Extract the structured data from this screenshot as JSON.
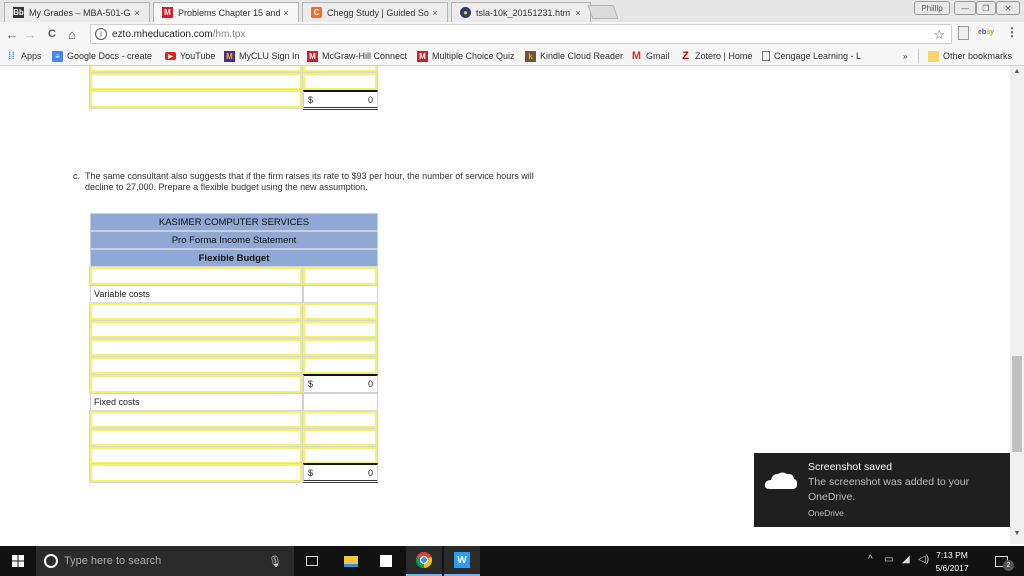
{
  "browser": {
    "tabs": [
      {
        "title": "My Grades – MBA-501-G",
        "icon": "blackboard-icon",
        "icon_text": "Bb",
        "icon_color": "#333333",
        "active": false
      },
      {
        "title": "Problems Chapter 15 and",
        "icon": "mcgraw-hill-icon",
        "icon_text": "M",
        "icon_color": "#d51f26",
        "active": true
      },
      {
        "title": "Chegg Study | Guided So",
        "icon": "chegg-icon",
        "icon_text": "C",
        "icon_color": "#f36c21",
        "active": false
      },
      {
        "title": "tsla-10k_20151231.htm",
        "icon": "sec-seal-icon",
        "icon_text": "●",
        "icon_color": "#2b3a67",
        "active": false
      }
    ],
    "close_glyph": "×",
    "profile_name": "Phillip",
    "window_controls": {
      "minimize": "—",
      "maximize": "❐",
      "close": "✕"
    },
    "nav": {
      "back": "←",
      "forward": "→",
      "reload": "C",
      "home": "⌂"
    },
    "url": {
      "host": "ezto.mheducation.com",
      "path": "/hm.tpx"
    },
    "bookmarks": [
      {
        "label": "Apps",
        "icon": "apps-grid-icon"
      },
      {
        "label": "Google Docs - create",
        "icon": "google-docs-icon"
      },
      {
        "label": "YouTube",
        "icon": "youtube-icon"
      },
      {
        "label": "MyCLU Sign In",
        "icon": "myclu-icon"
      },
      {
        "label": "McGraw-Hill Connect",
        "icon": "mcgraw-hill-icon"
      },
      {
        "label": "Multiple Choice Quiz",
        "icon": "mcgraw-hill-icon"
      },
      {
        "label": "Kindle Cloud Reader",
        "icon": "kindle-icon"
      },
      {
        "label": "Gmail",
        "icon": "gmail-icon"
      },
      {
        "label": "Zotero | Home",
        "icon": "zotero-icon"
      },
      {
        "label": "Cengage Learning - L",
        "icon": "page-icon"
      }
    ],
    "overflow": "»",
    "other_bookmarks": "Other bookmarks",
    "ext_ebay": "ebay"
  },
  "page": {
    "prev_table": {
      "total_currency": "$",
      "total_value": "0"
    },
    "question": {
      "label": "c.",
      "text": "The same consultant also suggests that if the firm raises its rate to $93 per hour, the number of service hours will decline to 27,000. Prepare a flexible budget using the new assumption."
    },
    "table": {
      "header": [
        "KASIMER COMPUTER SERVICES",
        "Pro Forma Income Statement",
        "Flexible Budget"
      ],
      "header_color": "#8fa8d4",
      "input_border_color": "#f3f06a",
      "variable_costs_label": "Variable costs",
      "variable_total": {
        "currency": "$",
        "value": "0"
      },
      "fixed_costs_label": "Fixed costs",
      "fixed_total": {
        "currency": "$",
        "value": "0"
      }
    }
  },
  "toast": {
    "title": "Screenshot saved",
    "body": "The screenshot was added to your OneDrive.",
    "app": "OneDrive"
  },
  "taskbar": {
    "search_placeholder": "Type here to search",
    "time": "7:13 PM",
    "date": "5/6/2017",
    "notification_count": "2"
  }
}
